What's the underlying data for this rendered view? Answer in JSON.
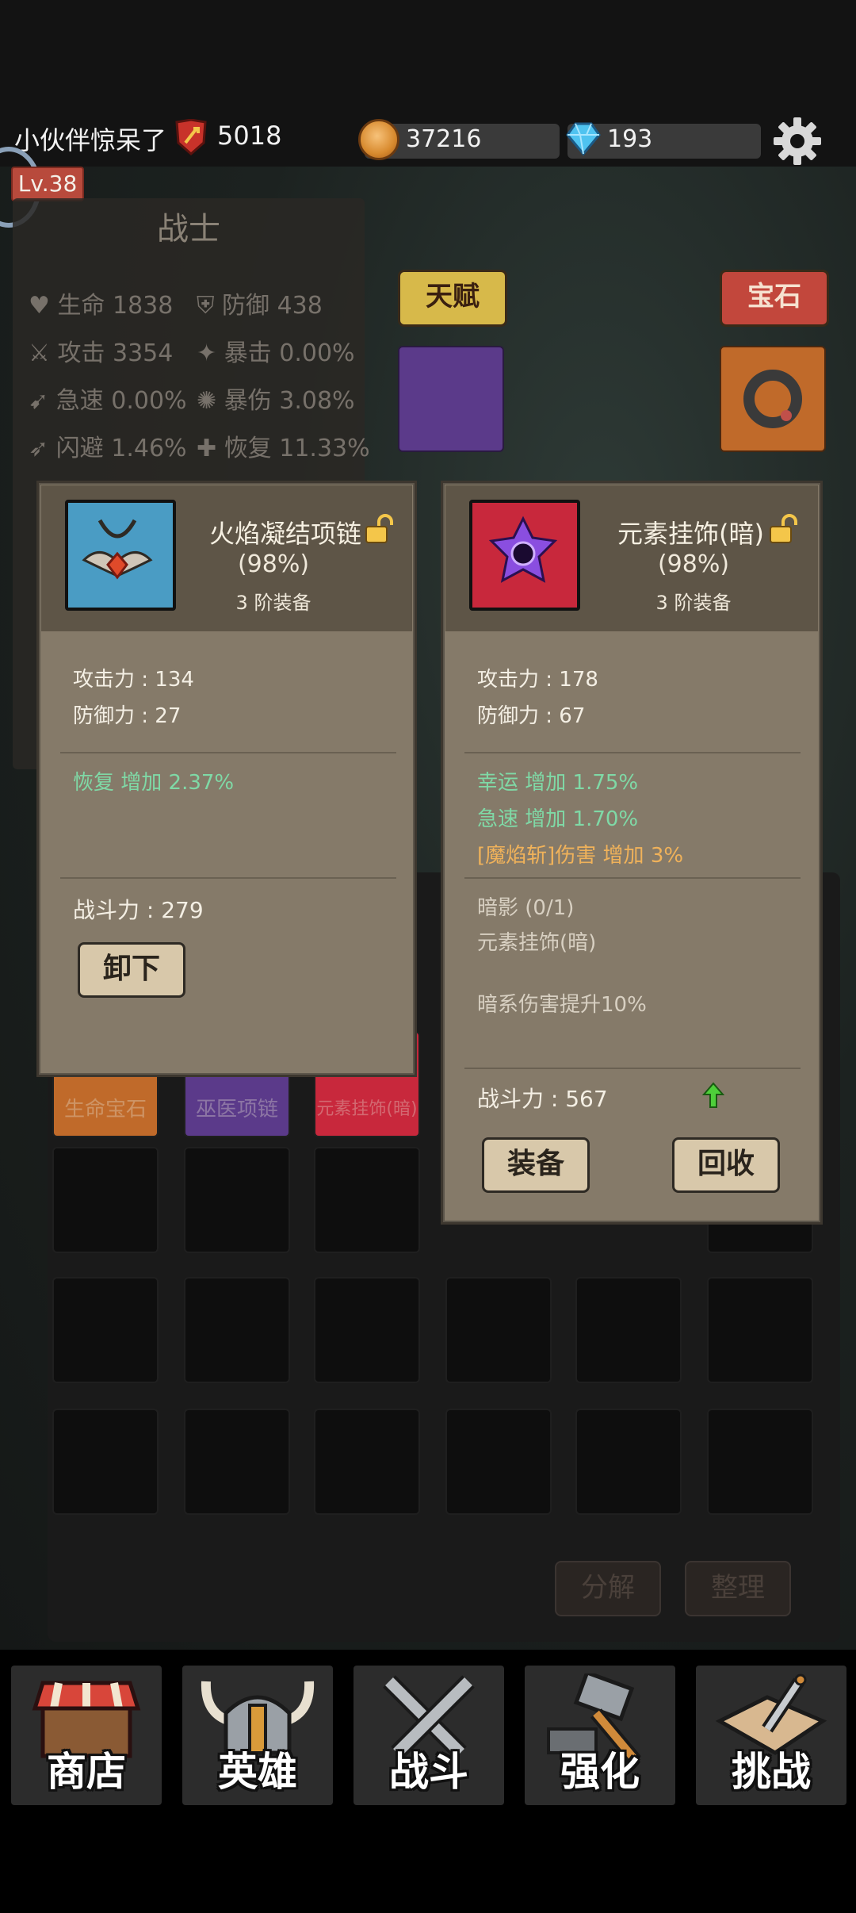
{
  "header": {
    "player_name": "小伙伴惊呆了",
    "power": "5018",
    "gold": "37216",
    "gems": "193",
    "level": "Lv.38"
  },
  "character": {
    "class": "战士",
    "stats": [
      {
        "label": "生命",
        "value": "1838"
      },
      {
        "label": "防御",
        "value": "438"
      },
      {
        "label": "攻击",
        "value": "3354"
      },
      {
        "label": "暴击",
        "value": "0.00%"
      },
      {
        "label": "急速",
        "value": "0.00%"
      },
      {
        "label": "暴伤",
        "value": "3.08%"
      },
      {
        "label": "闪避",
        "value": "1.46%"
      },
      {
        "label": "恢复",
        "value": "11.33%"
      }
    ],
    "talent_button": "天赋",
    "gem_button": "宝石"
  },
  "inventory": {
    "visible_item_labels": [
      "生命宝石",
      "巫医项链",
      "元素挂饰(暗)"
    ],
    "decompose_button": "分解",
    "sort_button": "整理"
  },
  "equipped_item": {
    "name": "火焰凝结项链",
    "quality": "(98%)",
    "tier": "3 阶装备",
    "attack": "攻击力 : 134",
    "defense": "防御力 : 27",
    "bonuses": [
      "恢复 增加 2.37%"
    ],
    "power": "战斗力 : 279",
    "unequip_button": "卸下",
    "frame_color": "#4a9cc4"
  },
  "new_item": {
    "name": "元素挂饰(暗)",
    "quality": "(98%)",
    "tier": "3 阶装备",
    "attack": "攻击力 : 178",
    "defense": "防御力 : 67",
    "bonuses": [
      "幸运 增加 1.75%",
      "急速 增加 1.70%"
    ],
    "special_bonus": "[魔焰斩]伤害 增加 3%",
    "set_name": "暗影 (0/1)",
    "set_piece": "元素挂饰(暗)",
    "set_effect": "暗系伤害提升10%",
    "power": "战斗力 : 567",
    "equip_button": "装备",
    "recycle_button": "回收",
    "frame_color": "#c8283c"
  },
  "nav": [
    {
      "label": "商店",
      "icon": "shop-stall-icon"
    },
    {
      "label": "英雄",
      "icon": "viking-helmet-icon"
    },
    {
      "label": "战斗",
      "icon": "crossed-swords-icon"
    },
    {
      "label": "强化",
      "icon": "hammer-icon"
    },
    {
      "label": "挑战",
      "icon": "map-sword-icon"
    }
  ]
}
